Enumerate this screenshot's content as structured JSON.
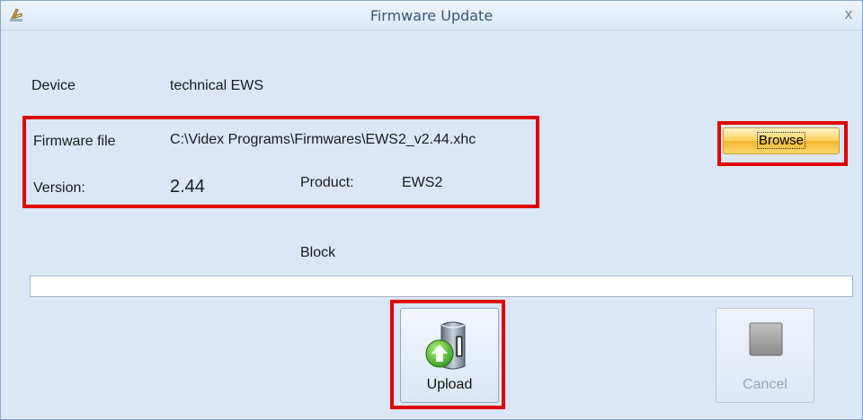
{
  "window": {
    "title": "Firmware Update",
    "close_glyph": "x",
    "icon": "app-icon"
  },
  "device": {
    "label": "Device",
    "value": "technical EWS"
  },
  "firmware": {
    "label": "Firmware file",
    "path": "C:\\Videx Programs\\Firmwares\\EWS2_v2.44.xhc"
  },
  "version": {
    "label": "Version:",
    "value": "2.44"
  },
  "product": {
    "label": "Product:",
    "value": "EWS2"
  },
  "browse": {
    "label": "Browse"
  },
  "block": {
    "label": "Block"
  },
  "progress": {
    "value": 0
  },
  "upload": {
    "label": "Upload",
    "icon": "upload-server-icon"
  },
  "cancel": {
    "label": "Cancel",
    "icon": "stop-icon",
    "enabled": false
  },
  "colors": {
    "highlight": "#e10000",
    "window_bg": "#d9e5f6",
    "browse_button": "#ffd258"
  }
}
